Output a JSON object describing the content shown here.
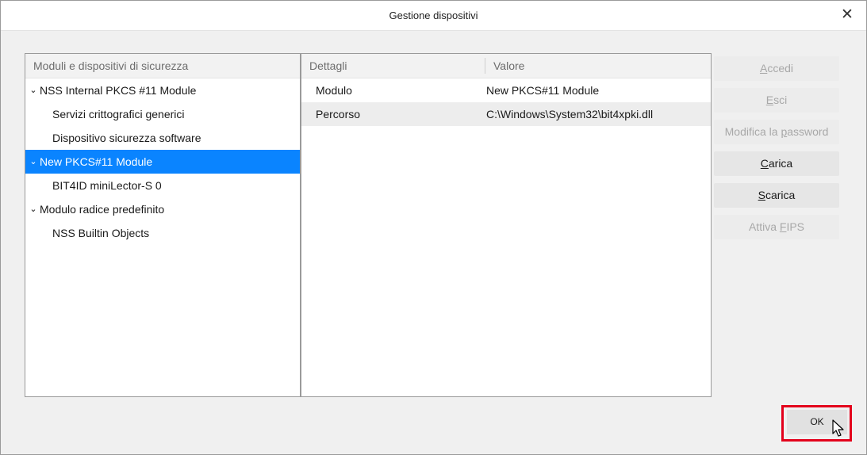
{
  "window": {
    "title": "Gestione dispositivi"
  },
  "icons": {
    "close": "close-icon",
    "expanded": "chevron-down-icon",
    "cursor": "mouse-pointer-icon"
  },
  "tree": {
    "header": "Moduli e dispositivi di sicurezza",
    "items": [
      {
        "label": "NSS Internal PKCS #11 Module",
        "expanded": true,
        "level": 0
      },
      {
        "label": "Servizi crittografici generici",
        "level": 1
      },
      {
        "label": "Dispositivo sicurezza software",
        "level": 1
      },
      {
        "label": "New PKCS#11 Module",
        "expanded": true,
        "level": 0,
        "selected": true
      },
      {
        "label": "BIT4ID miniLector-S 0",
        "level": 1
      },
      {
        "label": "Modulo radice predefinito",
        "expanded": true,
        "level": 0
      },
      {
        "label": "NSS Builtin Objects",
        "level": 1
      }
    ]
  },
  "details": {
    "header_key": "Dettagli",
    "header_value": "Valore",
    "rows": [
      {
        "key": "Modulo",
        "value": "New PKCS#11 Module"
      },
      {
        "key": "Percorso",
        "value": "C:\\Windows\\System32\\bit4xpki.dll"
      }
    ]
  },
  "buttons": {
    "login": {
      "pre": "",
      "accel": "A",
      "post": "ccedi",
      "enabled": false
    },
    "logout": {
      "pre": "",
      "accel": "E",
      "post": "sci",
      "enabled": false
    },
    "change_password": {
      "pre": "Modifica la ",
      "accel": "p",
      "post": "assword",
      "enabled": false
    },
    "load": {
      "pre": "",
      "accel": "C",
      "post": "arica",
      "enabled": true
    },
    "unload": {
      "pre": "",
      "accel": "S",
      "post": "carica",
      "enabled": true
    },
    "enable_fips": {
      "pre": "Attiva ",
      "accel": "F",
      "post": "IPS",
      "enabled": false
    },
    "ok": "OK"
  },
  "colors": {
    "selection": "#0a84ff",
    "highlight": "#e3001b"
  }
}
